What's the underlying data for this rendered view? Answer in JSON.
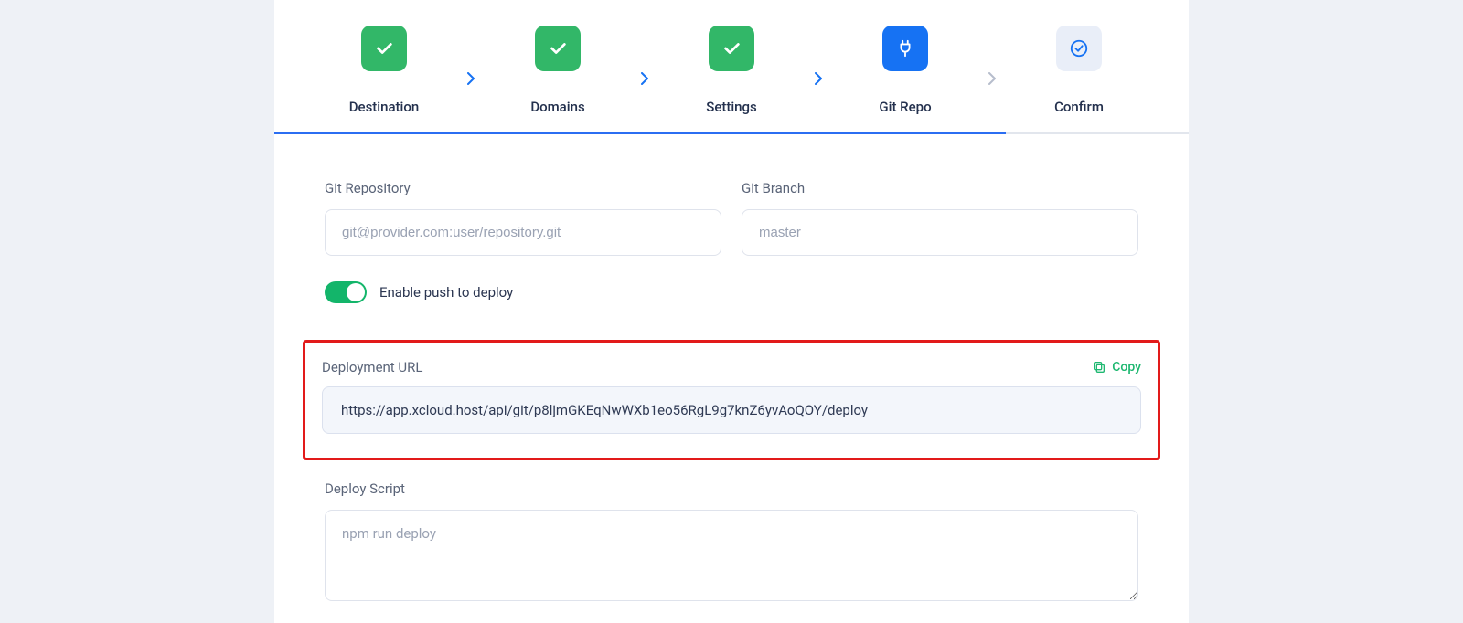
{
  "stepper": {
    "steps": [
      {
        "label": "Destination",
        "state": "done"
      },
      {
        "label": "Domains",
        "state": "done"
      },
      {
        "label": "Settings",
        "state": "done"
      },
      {
        "label": "Git Repo",
        "state": "active"
      },
      {
        "label": "Confirm",
        "state": "pending"
      }
    ]
  },
  "form": {
    "git_repo_label": "Git Repository",
    "git_repo_placeholder": "git@provider.com:user/repository.git",
    "git_repo_value": "",
    "git_branch_label": "Git Branch",
    "git_branch_placeholder": "master",
    "git_branch_value": "",
    "toggle_label": "Enable push to deploy",
    "toggle_on": true,
    "deploy_url_label": "Deployment URL",
    "copy_label": "Copy",
    "deploy_url_value": "https://app.xcloud.host/api/git/p8ljmGKEqNwWXb1eo56RgL9g7knZ6yvAoQOY/deploy",
    "deploy_script_label": "Deploy Script",
    "deploy_script_placeholder": "npm run deploy",
    "deploy_script_value": ""
  },
  "colors": {
    "brand_blue": "#1672f3",
    "success_green": "#32b768",
    "copy_green": "#1fb871",
    "highlight_red": "#e21a1a"
  }
}
